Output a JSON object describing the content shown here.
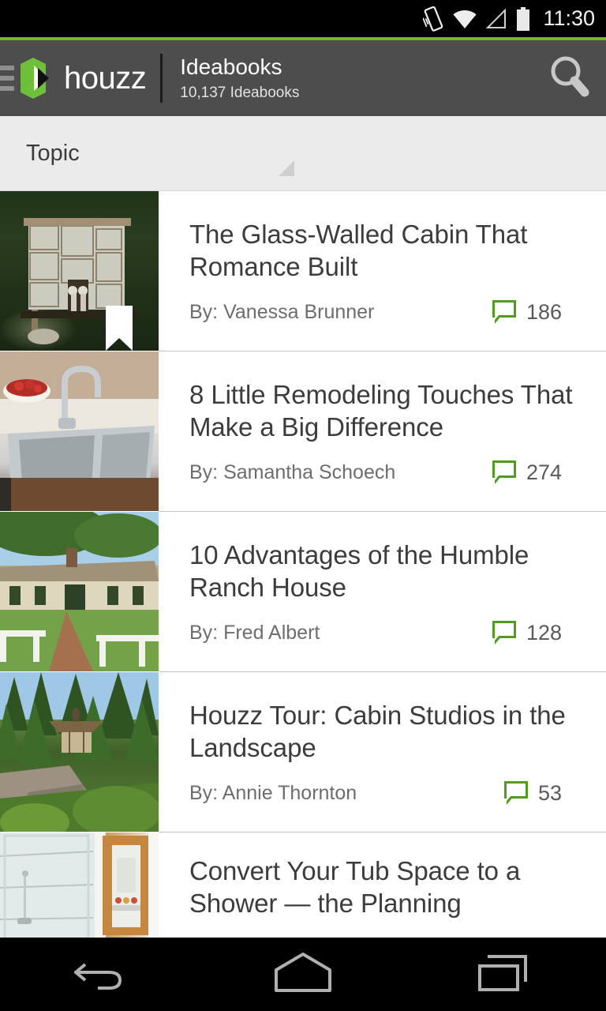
{
  "status_bar": {
    "time": "11:30",
    "icons": [
      "vibrate-icon",
      "wifi-icon",
      "cell-signal-icon",
      "battery-icon"
    ]
  },
  "header": {
    "menu_icon": "hamburger-menu-icon",
    "brand": "houzz",
    "title": "Ideabooks",
    "subtitle": "10,137 Ideabooks",
    "search_icon": "search-icon",
    "accent_color": "#76b72a",
    "background_color": "#4d4d4d"
  },
  "filter_bar": {
    "label": "Topic",
    "caret_icon": "triangle-dropdown-icon",
    "background_color": "#ebebeb"
  },
  "list": {
    "comment_icon": "comment-bubble-icon",
    "comment_icon_color": "#4f9c1e",
    "bookmark_icon": "bookmark-flag-icon",
    "items": [
      {
        "title": "The Glass-Walled Cabin That Romance Built",
        "author": "By: Vanessa Brunner",
        "comments": "186",
        "thumb_class": "sc-cabin",
        "bookmarked": true
      },
      {
        "title": "8 Little Remodeling Touches That Make a Big Difference",
        "author": "By: Samantha Schoech",
        "comments": "274",
        "thumb_class": "sc-sink",
        "bookmarked": false
      },
      {
        "title": "10 Advantages of the Humble Ranch House",
        "author": "By: Fred Albert",
        "comments": "128",
        "thumb_class": "sc-ranch",
        "bookmarked": false
      },
      {
        "title": "Houzz Tour: Cabin Studios in the Landscape",
        "author": "By: Annie Thornton",
        "comments": "53",
        "thumb_class": "sc-forest",
        "bookmarked": false
      },
      {
        "title": "Convert Your Tub Space to a Shower — the Planning",
        "author": "",
        "comments": "",
        "thumb_class": "sc-bath",
        "bookmarked": false
      }
    ]
  },
  "nav_bar": {
    "back_icon": "back-arrow-icon",
    "home_icon": "home-icon",
    "recents_icon": "recent-apps-icon"
  }
}
